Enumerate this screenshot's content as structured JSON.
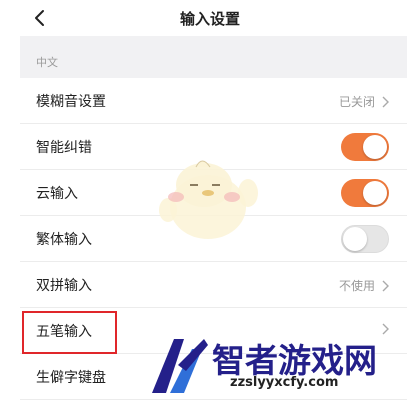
{
  "nav": {
    "title": "输入设置",
    "back_icon": "chevron-left-icon"
  },
  "section": {
    "header": "中文"
  },
  "rows": [
    {
      "label": "模糊音设置",
      "type": "value",
      "value": "已关闭"
    },
    {
      "label": "智能纠错",
      "type": "toggle",
      "on": true
    },
    {
      "label": "云输入",
      "type": "toggle",
      "on": true
    },
    {
      "label": "繁体输入",
      "type": "toggle",
      "on": false
    },
    {
      "label": "双拼输入",
      "type": "value",
      "value": "不使用"
    },
    {
      "label": "五笔输入",
      "type": "link",
      "value": ""
    },
    {
      "label": "生僻字键盘",
      "type": "link",
      "value": ""
    }
  ],
  "highlighted_row": "五笔输入",
  "colors": {
    "accent": "#f07a3c",
    "highlight": "#e0262a",
    "watermark": "#24208a"
  },
  "watermark": {
    "title": "智者游戏网",
    "url": "zzslyyxcfy.com"
  }
}
